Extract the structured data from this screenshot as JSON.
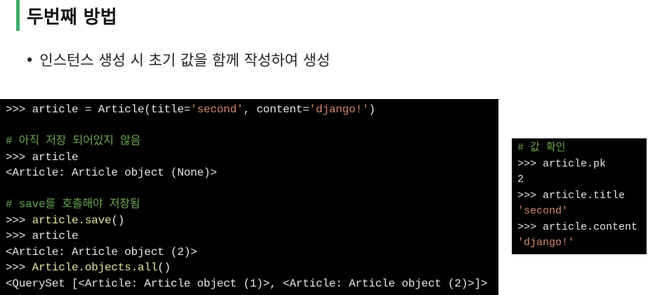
{
  "colors": {
    "accent": "#3fae6a",
    "comment": "#6aa84f",
    "string": "#d4886a",
    "call": "#e7e3a0",
    "panel_bg": "#000000"
  },
  "header": {
    "title": "두번째 방법"
  },
  "bullet": {
    "symbol": "•",
    "text": "인스턴스 생성 시 초기 값을 함께 작성하여 생성"
  },
  "code_main": [
    [
      {
        "t": ">>> article = Article(title=",
        "c": "plain"
      },
      {
        "t": "'second'",
        "c": "str"
      },
      {
        "t": ", content=",
        "c": "plain"
      },
      {
        "t": "'django!'",
        "c": "str"
      },
      {
        "t": ")",
        "c": "plain"
      }
    ],
    [],
    [
      {
        "t": "# 아직 저장 되어있지 않음",
        "c": "comment"
      }
    ],
    [
      {
        "t": ">>> article",
        "c": "plain"
      }
    ],
    [
      {
        "t": "<Article: Article object (None)>",
        "c": "plain"
      }
    ],
    [],
    [
      {
        "t": "# save를 호출해야 저장됨",
        "c": "comment"
      }
    ],
    [
      {
        "t": ">>> ",
        "c": "plain"
      },
      {
        "t": "article.save",
        "c": "call"
      },
      {
        "t": "()",
        "c": "plain"
      }
    ],
    [
      {
        "t": ">>> article",
        "c": "plain"
      }
    ],
    [
      {
        "t": "<Article: Article object (2)>",
        "c": "plain"
      }
    ],
    [
      {
        "t": ">>> ",
        "c": "plain"
      },
      {
        "t": "Article.objects.all",
        "c": "call"
      },
      {
        "t": "()",
        "c": "plain"
      }
    ],
    [
      {
        "t": "<QuerySet [<Article: Article object (1)>, <Article: Article object (2)>]>",
        "c": "plain"
      }
    ]
  ],
  "code_side": [
    [
      {
        "t": "# 값 확인",
        "c": "comment"
      }
    ],
    [
      {
        "t": ">>> article.pk",
        "c": "plain"
      }
    ],
    [
      {
        "t": "2",
        "c": "plain"
      }
    ],
    [
      {
        "t": ">>> article.title",
        "c": "plain"
      }
    ],
    [
      {
        "t": "'second'",
        "c": "str"
      }
    ],
    [
      {
        "t": ">>> article.content",
        "c": "plain"
      }
    ],
    [
      {
        "t": "'django!'",
        "c": "str"
      }
    ]
  ]
}
